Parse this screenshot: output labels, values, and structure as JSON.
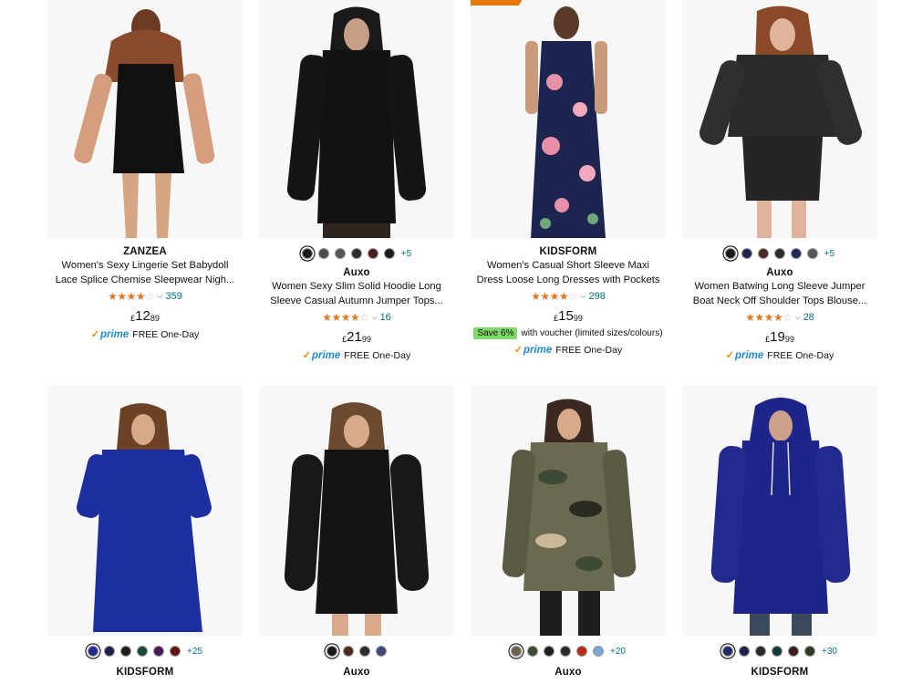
{
  "products": [
    {
      "brand": "ZANZEA",
      "title": "Women's Sexy Lingerie Set Babydoll Lace Splice Chemise Sleepwear Nigh...",
      "rating_count": "359",
      "price": {
        "currency": "£",
        "whole": "12",
        "fraction": "89"
      },
      "delivery": "FREE One-Day",
      "dress_color": "#111111"
    },
    {
      "brand": "Auxo",
      "title": "Women Sexy Slim Solid Hoodie Long Sleeve Casual Autumn Jumper Tops...",
      "rating_count": "16",
      "price": {
        "currency": "£",
        "whole": "21",
        "fraction": "99"
      },
      "delivery": "FREE One-Day",
      "swatches": [
        "#1a1a1a",
        "#4a4a4a",
        "#555555",
        "#2c2c2c",
        "#4a1e1a",
        "#1e1e1e"
      ],
      "more_colors": "+5",
      "dress_color": "#121212"
    },
    {
      "brand": "KIDSFORM",
      "title": "Women's Casual Short Sleeve Maxi Dress Loose Long Dresses with Pockets",
      "rating_count": "298",
      "price": {
        "currency": "£",
        "whole": "15",
        "fraction": "99"
      },
      "save_badge": "Save 6%",
      "save_text": "with voucher (limited sizes/colours)",
      "delivery": "FREE One-Day",
      "dress_color": "#1c2550"
    },
    {
      "brand": "Auxo",
      "title": "Women Batwing Long Sleeve Jumper Boat Neck Off Shoulder Tops Blouse...",
      "rating_count": "28",
      "price": {
        "currency": "£",
        "whole": "19",
        "fraction": "99"
      },
      "delivery": "FREE One-Day",
      "swatches": [
        "#1a1a1a",
        "#1e2450",
        "#4a2a22",
        "#2c2c2c",
        "#1f2a5a",
        "#555555"
      ],
      "more_colors": "+5",
      "dress_color": "#2a2a2a"
    },
    {
      "brand": "KIDSFORM",
      "swatches": [
        "#1f2a8a",
        "#1e2450",
        "#1e1e1e",
        "#154a3a",
        "#4a1a5a",
        "#5a1414"
      ],
      "more_colors": "+25",
      "dress_color": "#1d2fa0"
    },
    {
      "brand": "Auxo",
      "swatches": [
        "#1a1a1a",
        "#4a2a18",
        "#2c2c2c",
        "#3a4a7a"
      ],
      "dress_color": "#141414"
    },
    {
      "brand": "Auxo",
      "swatches": [
        "#6b6250",
        "#3e4a34",
        "#1e1e1e",
        "#2a2a2a",
        "#b82a1a",
        "#7aa6d6"
      ],
      "more_colors": "+20",
      "dress_color": "#6a6a50"
    },
    {
      "brand": "KIDSFORM",
      "swatches": [
        "#1e2a6a",
        "#1e2450",
        "#2a2a2a",
        "#133a3a",
        "#3a1e1a",
        "#2e3a22"
      ],
      "more_colors": "+30",
      "dress_color": "#1e258a"
    }
  ],
  "prime_label": "prime",
  "prime_check": "✓"
}
